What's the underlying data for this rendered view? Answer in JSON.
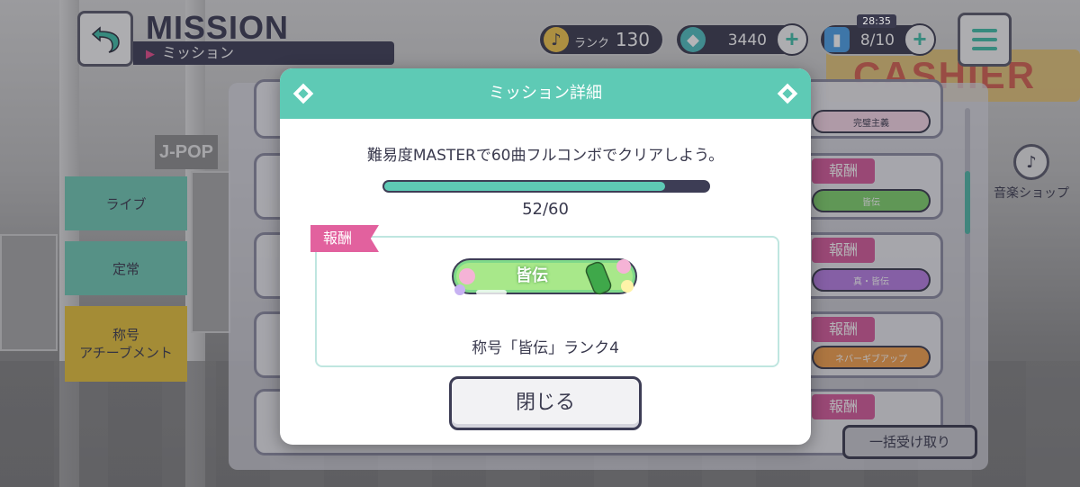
{
  "header": {
    "title": "MISSION",
    "subtitle": "ミッション",
    "rank_label": "ランク",
    "rank_value": "130",
    "crystal_value": "3440",
    "stamina_timer": "28:35",
    "stamina_value": "8/10"
  },
  "sidebar": {
    "items": [
      {
        "label": "ライブ"
      },
      {
        "label": "定常"
      },
      {
        "label": "称号\nアチーブメント"
      }
    ]
  },
  "background_list": {
    "reward_tag": "報酬",
    "chips": [
      "完璧主義",
      "皆伝",
      "真・皆伝",
      "ネバーギブアップ"
    ],
    "music_shop": "音楽ショップ",
    "receive_all": "一括受け取り",
    "cashier_sign": "CASHIER",
    "jpop_sign": "J-POP"
  },
  "modal": {
    "title": "ミッション詳細",
    "description": "難易度MASTERで60曲フルコンボでクリアしよう。",
    "progress_current": 52,
    "progress_total": 60,
    "progress_text": "52/60",
    "reward_label": "報酬",
    "reward_badge_text": "皆伝",
    "reward_name": "称号「皆伝」ランク4",
    "close_label": "閉じる"
  },
  "colors": {
    "accent": "#5ecab5",
    "reward_pink": "#e2619e",
    "dark": "#3d3d55"
  }
}
